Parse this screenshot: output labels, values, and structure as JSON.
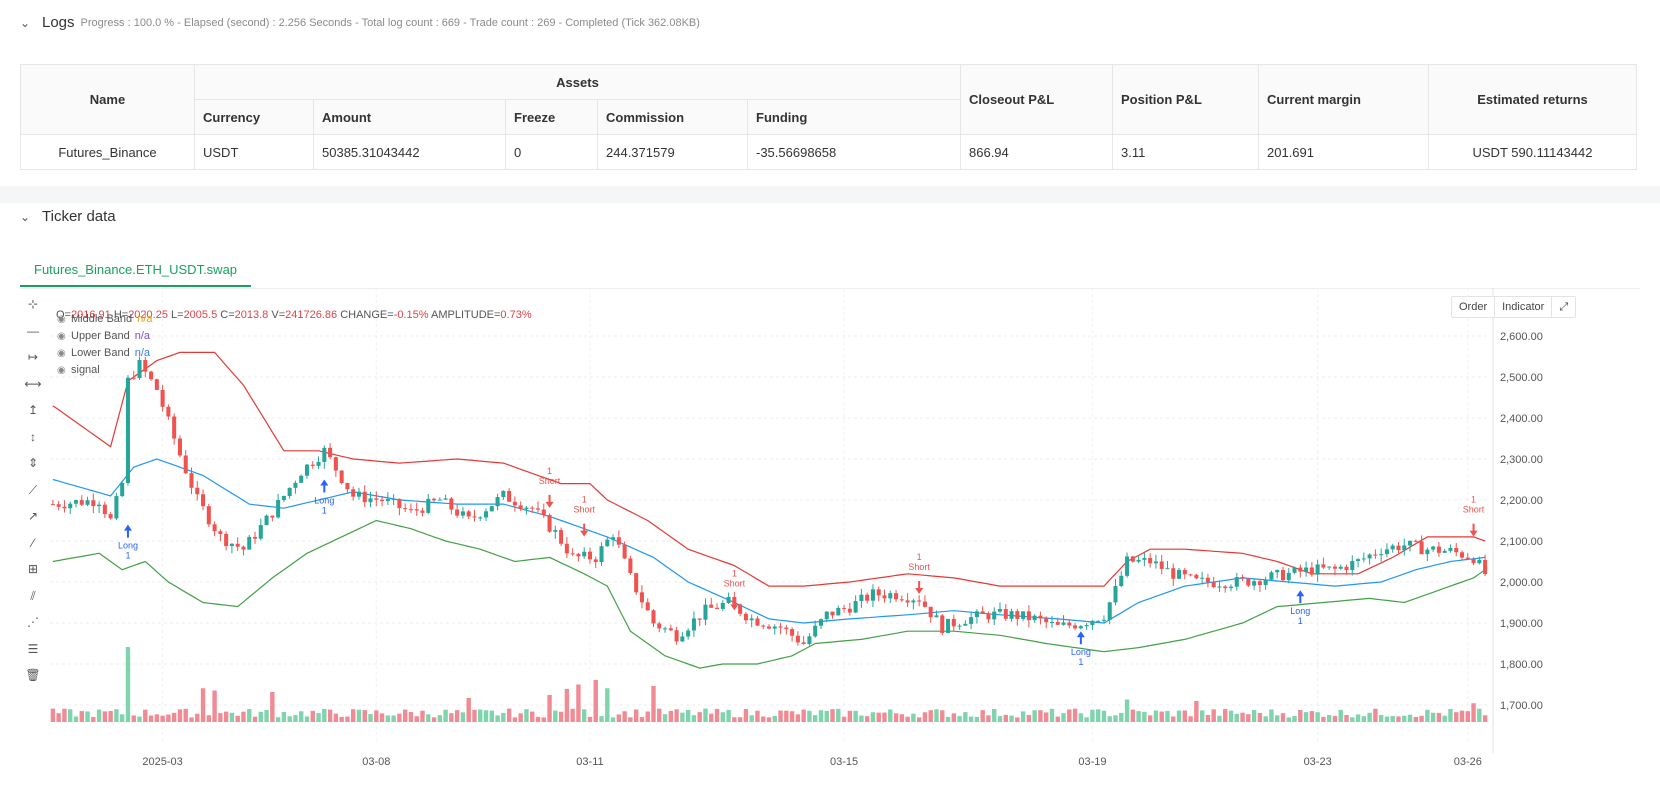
{
  "logs": {
    "title": "Logs",
    "status": "Progress : 100.0 % - Elapsed (second) : 2.256  Seconds - Total log count : 669 - Trade count : 269 - Completed (Tick 362.08KB)"
  },
  "assets_table": {
    "headers": {
      "name": "Name",
      "assets": "Assets",
      "currency": "Currency",
      "amount": "Amount",
      "freeze": "Freeze",
      "commission": "Commission",
      "funding": "Funding",
      "closeout": "Closeout P&L",
      "position": "Position P&L",
      "margin": "Current margin",
      "returns": "Estimated returns"
    },
    "row": {
      "name": "Futures_Binance",
      "currency": "USDT",
      "amount": "50385.31043442",
      "freeze": "0",
      "commission": "244.371579",
      "funding": "-35.56698658",
      "closeout": "866.94",
      "position": "3.11",
      "margin": "201.691",
      "returns": "USDT 590.11143442"
    }
  },
  "ticker": {
    "title": "Ticker data",
    "tab": "Futures_Binance.ETH_USDT.swap",
    "ohlc": {
      "o_label": "O=",
      "o": "2016.91",
      "h_label": "H=",
      "h": "2020.25",
      "l_label": "L=",
      "l": "2005.5",
      "c_label": "C=",
      "c": "2013.8",
      "v_label": "V=",
      "v": "241726.86",
      "chg_label": "CHANGE=",
      "chg": "-0.15%",
      "amp_label": "AMPLITUDE=",
      "amp": "0.73%"
    },
    "legend": [
      {
        "name": "Middle Band",
        "value": "n/a",
        "color": "#f0a020"
      },
      {
        "name": "Upper Band",
        "value": "n/a",
        "color": "#7a4fc9"
      },
      {
        "name": "Lower Band",
        "value": "n/a",
        "color": "#2f7fe0"
      },
      {
        "name": "signal",
        "value": ""
      }
    ],
    "buttons": {
      "order": "Order",
      "indicator": "Indicator",
      "fullscreen_icon": "expand-icon"
    },
    "toolbar_icons": [
      "crosshair-icon",
      "horizontal-line-icon",
      "horizontal-ray-icon",
      "extended-line-icon",
      "vertical-ray-icon",
      "vertical-line-icon",
      "vertical-segment-icon",
      "trend-line-icon",
      "ray-icon",
      "segment-icon",
      "price-range-icon",
      "parallel-channel-icon",
      "fib-channel-icon",
      "fib-retracement-icon",
      "delete-icon"
    ],
    "colors": {
      "up": "#26a69a",
      "down": "#ef5350",
      "upper": "#e53935",
      "middle": "#2196f3",
      "lower": "#43a047",
      "marker": "#2962ff"
    }
  },
  "chart_data": {
    "type": "candlestick",
    "y_ticks": [
      "2,600.00",
      "2,500.00",
      "2,400.00",
      "2,300.00",
      "2,200.00",
      "2,100.00",
      "2,000.00",
      "1,900.00",
      "1,800.00",
      "1,700.00"
    ],
    "x_ticks": [
      "2025-03",
      "03-08",
      "03-11",
      "03-15",
      "03-19",
      "03-23",
      "03-26"
    ],
    "ylim": [
      1680,
      2640
    ],
    "price_anchors": [
      [
        0,
        2190
      ],
      [
        8,
        2200
      ],
      [
        10,
        2150
      ],
      [
        12,
        2240
      ],
      [
        13,
        2490
      ],
      [
        15,
        2530
      ],
      [
        18,
        2470
      ],
      [
        22,
        2310
      ],
      [
        25,
        2200
      ],
      [
        29,
        2110
      ],
      [
        33,
        2080
      ],
      [
        38,
        2170
      ],
      [
        43,
        2270
      ],
      [
        47,
        2320
      ],
      [
        52,
        2210
      ],
      [
        57,
        2200
      ],
      [
        62,
        2170
      ],
      [
        67,
        2200
      ],
      [
        72,
        2150
      ],
      [
        78,
        2210
      ],
      [
        83,
        2180
      ],
      [
        87,
        2120
      ],
      [
        90,
        2060
      ],
      [
        94,
        2060
      ],
      [
        97,
        2120
      ],
      [
        100,
        2010
      ],
      [
        104,
        1900
      ],
      [
        108,
        1870
      ],
      [
        113,
        1930
      ],
      [
        117,
        1950
      ],
      [
        121,
        1910
      ],
      [
        126,
        1890
      ],
      [
        130,
        1850
      ],
      [
        134,
        1920
      ],
      [
        138,
        1940
      ],
      [
        142,
        1970
      ],
      [
        146,
        1970
      ],
      [
        150,
        1960
      ],
      [
        154,
        1890
      ],
      [
        158,
        1910
      ],
      [
        162,
        1920
      ],
      [
        166,
        1920
      ],
      [
        170,
        1910
      ],
      [
        174,
        1890
      ],
      [
        178,
        1900
      ],
      [
        182,
        1920
      ],
      [
        184,
        1980
      ],
      [
        186,
        2050
      ],
      [
        190,
        2050
      ],
      [
        194,
        2020
      ],
      [
        198,
        2000
      ],
      [
        202,
        2000
      ],
      [
        206,
        2000
      ],
      [
        210,
        2010
      ],
      [
        214,
        2020
      ],
      [
        218,
        2030
      ],
      [
        222,
        2030
      ],
      [
        226,
        2050
      ],
      [
        230,
        2080
      ],
      [
        234,
        2090
      ],
      [
        238,
        2080
      ],
      [
        242,
        2075
      ],
      [
        246,
        2060
      ],
      [
        248,
        2020
      ]
    ],
    "upper_band": [
      [
        0,
        2430
      ],
      [
        10,
        2330
      ],
      [
        13,
        2490
      ],
      [
        18,
        2540
      ],
      [
        22,
        2560
      ],
      [
        28,
        2560
      ],
      [
        33,
        2480
      ],
      [
        40,
        2320
      ],
      [
        46,
        2320
      ],
      [
        52,
        2300
      ],
      [
        60,
        2290
      ],
      [
        70,
        2300
      ],
      [
        78,
        2290
      ],
      [
        84,
        2260
      ],
      [
        88,
        2240
      ],
      [
        93,
        2240
      ],
      [
        96,
        2200
      ],
      [
        103,
        2150
      ],
      [
        110,
        2080
      ],
      [
        118,
        2040
      ],
      [
        124,
        1990
      ],
      [
        130,
        1990
      ],
      [
        138,
        2000
      ],
      [
        148,
        2020
      ],
      [
        156,
        2010
      ],
      [
        164,
        1990
      ],
      [
        174,
        1990
      ],
      [
        182,
        1990
      ],
      [
        186,
        2050
      ],
      [
        190,
        2080
      ],
      [
        196,
        2080
      ],
      [
        206,
        2070
      ],
      [
        212,
        2050
      ],
      [
        218,
        2020
      ],
      [
        226,
        2020
      ],
      [
        232,
        2060
      ],
      [
        238,
        2110
      ],
      [
        246,
        2110
      ],
      [
        248,
        2100
      ]
    ],
    "middle_band": [
      [
        0,
        2250
      ],
      [
        10,
        2210
      ],
      [
        14,
        2280
      ],
      [
        18,
        2300
      ],
      [
        26,
        2260
      ],
      [
        34,
        2190
      ],
      [
        40,
        2180
      ],
      [
        46,
        2200
      ],
      [
        52,
        2220
      ],
      [
        60,
        2200
      ],
      [
        70,
        2190
      ],
      [
        78,
        2190
      ],
      [
        86,
        2160
      ],
      [
        92,
        2130
      ],
      [
        96,
        2110
      ],
      [
        104,
        2060
      ],
      [
        110,
        2000
      ],
      [
        118,
        1950
      ],
      [
        124,
        1910
      ],
      [
        130,
        1900
      ],
      [
        138,
        1910
      ],
      [
        148,
        1920
      ],
      [
        156,
        1930
      ],
      [
        164,
        1920
      ],
      [
        174,
        1910
      ],
      [
        182,
        1900
      ],
      [
        188,
        1950
      ],
      [
        196,
        1990
      ],
      [
        206,
        2010
      ],
      [
        214,
        2000
      ],
      [
        222,
        1990
      ],
      [
        230,
        2000
      ],
      [
        236,
        2030
      ],
      [
        242,
        2050
      ],
      [
        248,
        2060
      ]
    ],
    "lower_band": [
      [
        0,
        2050
      ],
      [
        8,
        2070
      ],
      [
        12,
        2030
      ],
      [
        16,
        2050
      ],
      [
        20,
        2000
      ],
      [
        26,
        1950
      ],
      [
        32,
        1940
      ],
      [
        38,
        2010
      ],
      [
        44,
        2070
      ],
      [
        50,
        2110
      ],
      [
        56,
        2150
      ],
      [
        62,
        2130
      ],
      [
        68,
        2100
      ],
      [
        74,
        2080
      ],
      [
        80,
        2050
      ],
      [
        86,
        2060
      ],
      [
        92,
        2020
      ],
      [
        96,
        1990
      ],
      [
        100,
        1880
      ],
      [
        106,
        1820
      ],
      [
        112,
        1790
      ],
      [
        116,
        1800
      ],
      [
        122,
        1800
      ],
      [
        128,
        1820
      ],
      [
        132,
        1850
      ],
      [
        140,
        1860
      ],
      [
        148,
        1880
      ],
      [
        156,
        1880
      ],
      [
        164,
        1870
      ],
      [
        172,
        1850
      ],
      [
        182,
        1830
      ],
      [
        188,
        1840
      ],
      [
        196,
        1860
      ],
      [
        206,
        1900
      ],
      [
        212,
        1940
      ],
      [
        220,
        1950
      ],
      [
        228,
        1960
      ],
      [
        234,
        1950
      ],
      [
        240,
        1980
      ],
      [
        246,
        2010
      ],
      [
        248,
        2030
      ]
    ],
    "volume_max": 100,
    "volume_peaks": [
      [
        13,
        100
      ],
      [
        26,
        45
      ],
      [
        28,
        42
      ],
      [
        38,
        40
      ],
      [
        72,
        32
      ],
      [
        86,
        36
      ],
      [
        89,
        44
      ],
      [
        91,
        50
      ],
      [
        94,
        56
      ],
      [
        96,
        45
      ],
      [
        104,
        48
      ],
      [
        186,
        30
      ],
      [
        198,
        28
      ],
      [
        246,
        25
      ]
    ],
    "annotations": [
      {
        "kind": "long",
        "bar": 13,
        "price": 2140,
        "label": "Long",
        "count": "1"
      },
      {
        "kind": "long",
        "bar": 47,
        "price": 2250,
        "label": "Long",
        "count": "1"
      },
      {
        "kind": "short",
        "bar": 86,
        "price": 2210,
        "label": "Short",
        "count": "1"
      },
      {
        "kind": "short",
        "bar": 92,
        "price": 2140,
        "label": "Short",
        "count": "1"
      },
      {
        "kind": "short",
        "bar": 118,
        "price": 1960,
        "label": "Short",
        "count": "1"
      },
      {
        "kind": "short",
        "bar": 150,
        "price": 2000,
        "label": "Short",
        "count": "1"
      },
      {
        "kind": "long",
        "bar": 178,
        "price": 1880,
        "label": "Long",
        "count": "1"
      },
      {
        "kind": "long",
        "bar": 216,
        "price": 1980,
        "label": "Long",
        "count": "1"
      },
      {
        "kind": "short",
        "bar": 246,
        "price": 2140,
        "label": "Short",
        "count": "1"
      }
    ]
  }
}
